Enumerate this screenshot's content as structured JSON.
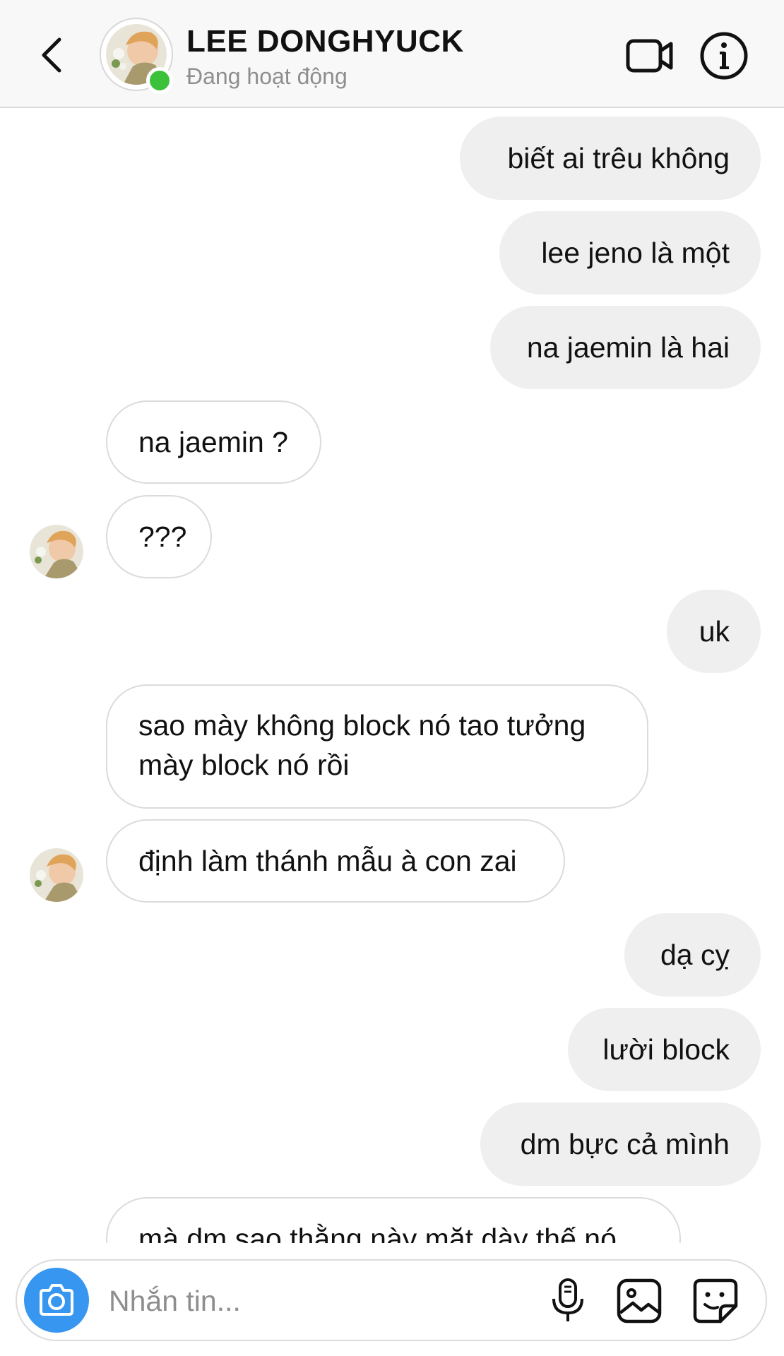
{
  "header": {
    "name": "LEE DONGHYUCK",
    "status": "Đang hoạt động"
  },
  "messages": [
    {
      "dir": "out",
      "text": "biết ai trêu không"
    },
    {
      "dir": "out",
      "text": "lee jeno là một"
    },
    {
      "dir": "out",
      "text": "na jaemin là hai"
    },
    {
      "dir": "in",
      "text": "na jaemin ?"
    },
    {
      "dir": "in",
      "text": "???"
    },
    {
      "dir": "out",
      "text": "uk"
    },
    {
      "dir": "in",
      "text": "sao mày không block nó tao tưởng mày block nó rồi"
    },
    {
      "dir": "in",
      "text": "định làm thánh mẫu à con zai"
    },
    {
      "dir": "out",
      "text": "dạ cỵ"
    },
    {
      "dir": "out",
      "text": "lười block"
    },
    {
      "dir": "out",
      "text": "dm bực cả mình"
    },
    {
      "dir": "in",
      "text": "mà dm sao thằng này mặt dày thế nó"
    }
  ],
  "composer": {
    "placeholder": "Nhắn tin..."
  },
  "colors": {
    "accent": "#3797f0",
    "online": "#3cc13b",
    "bubble_out": "#efefef",
    "bubble_in_border": "#dbdbdb"
  },
  "icons": {
    "back": "chevron-left-icon",
    "video": "video-camera-icon",
    "info": "info-icon",
    "camera": "camera-icon",
    "mic": "microphone-icon",
    "gallery": "image-icon",
    "sticker": "sticker-icon"
  }
}
